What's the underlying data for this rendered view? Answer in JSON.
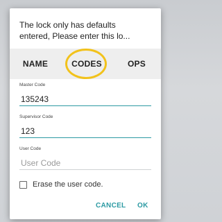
{
  "dialog": {
    "message_line1": "The lock only has defaults",
    "message_line2": "entered, Please enter this lo..."
  },
  "tabs": [
    {
      "label": "NAME"
    },
    {
      "label": "CODES"
    },
    {
      "label": "OPS"
    }
  ],
  "fields": {
    "master": {
      "label": "Master Code",
      "value": "135243",
      "placeholder": ""
    },
    "supervisor": {
      "label": "Supervisor Code",
      "value": "123",
      "placeholder": ""
    },
    "user": {
      "label": "User Code",
      "value": "",
      "placeholder": "User Code"
    }
  },
  "erase_checkbox": {
    "label": "Erase the user code.",
    "checked": false
  },
  "buttons": {
    "cancel": "CANCEL",
    "ok": "OK"
  },
  "colors": {
    "accent": "#2c9aa3",
    "highlight": "#f2c21b"
  }
}
